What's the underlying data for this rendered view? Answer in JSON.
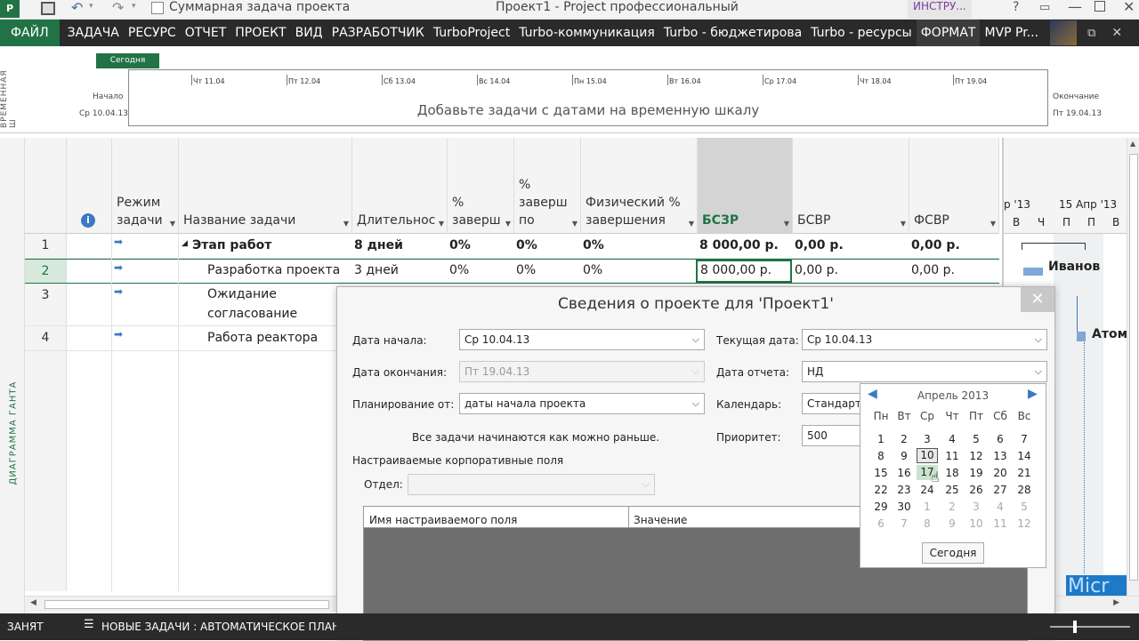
{
  "titlebar": {
    "checkbox_label": "Суммарная задача проекта",
    "window_title": "Проект1 - Project профессиональный",
    "tool_tab": "ИНСТРУ..."
  },
  "ribbon": {
    "tabs": [
      "ФАЙЛ",
      "ЗАДАЧА",
      "РЕСУРС",
      "ОТЧЕТ",
      "ПРОЕКТ",
      "ВИД",
      "РАЗРАБОТЧИК",
      "TurboProject",
      "Turbo-коммуникация",
      "Turbo - бюджетирова",
      "Turbo - ресурсы",
      "ФОРМАТ",
      "MVP Pr..."
    ]
  },
  "timeline": {
    "side_label": "ВРЕМЕННАЯ Ш",
    "today_label": "Сегодня",
    "start_label": "Начало",
    "start_date": "Ср 10.04.13",
    "end_label": "Окончание",
    "end_date": "Пт 19.04.13",
    "placeholder": "Добавьте задачи с датами на временную шкалу",
    "ticks": [
      "Чт 11.04",
      "Пт 12.04",
      "Сб 13.04",
      "Вс 14.04",
      "Пн 15.04",
      "Вт 16.04",
      "Ср 17.04",
      "Чт 18.04",
      "Пт 19.04"
    ]
  },
  "gantt_side_label": "ДИАГРАММА ГАНТА",
  "grid": {
    "headers": {
      "mode": "Режим задачи",
      "name": "Название задачи",
      "duration": "Длительнос",
      "pct": "% заверш",
      "pct_work": "% заверш по",
      "phys": "Физический % завершения",
      "bcws": "БСЗР",
      "bcwp": "БСВР",
      "acwp": "ФСВР"
    },
    "rows": [
      {
        "num": "1",
        "name": "Этап работ",
        "duration": "8 дней",
        "pct": "0%",
        "pct_work": "0%",
        "phys": "0%",
        "bcws": "8 000,00 р.",
        "bcwp": "0,00 р.",
        "acwp": "0,00 р."
      },
      {
        "num": "2",
        "name": "Разработка проекта",
        "duration": "3 дней",
        "pct": "0%",
        "pct_work": "0%",
        "phys": "0%",
        "bcws": "8 000,00 р.",
        "bcwp": "0,00 р.",
        "acwp": "0,00 р."
      },
      {
        "num": "3",
        "name": "Ожидание согласование",
        "name_line1": "Ожидание",
        "name_line2": "согласование"
      },
      {
        "num": "4",
        "name": "Работа реактора"
      }
    ]
  },
  "gantt": {
    "hdr_left": "р '13",
    "hdr_right": "15 Апр '13",
    "days": [
      "В",
      "Ч",
      "П",
      "П",
      "В"
    ],
    "label_ivanov": "Иванов",
    "label_atom": "Атом",
    "label_micro": "Micr"
  },
  "dialog": {
    "title": "Сведения о проекте для 'Проект1'",
    "start_date_label": "Дата начала:",
    "start_date_value": "Ср 10.04.13",
    "end_date_label": "Дата окончания:",
    "end_date_value": "Пт 19.04.13",
    "schedule_from_label": "Планирование от:",
    "schedule_from_value": "даты начала проекта",
    "note": "Все задачи начинаются как можно раньше.",
    "current_date_label": "Текущая дата:",
    "current_date_value": "Ср 10.04.13",
    "status_date_label": "Дата отчета:",
    "status_date_value": "НД",
    "calendar_label": "Календарь:",
    "calendar_value": "Стандартн",
    "priority_label": "Приоритет:",
    "priority_value": "500",
    "custom_fields_label": "Настраиваемые корпоративные поля",
    "department_label": "Отдел:",
    "col_field_name": "Имя настраиваемого поля",
    "col_value": "Значение"
  },
  "calendar": {
    "month": "Апрель 2013",
    "weekdays": [
      "Пн",
      "Вт",
      "Ср",
      "Чт",
      "Пт",
      "Сб",
      "Вс"
    ],
    "weeks": [
      [
        "1",
        "2",
        "3",
        "4",
        "5",
        "6",
        "7"
      ],
      [
        "8",
        "9",
        "10",
        "11",
        "12",
        "13",
        "14"
      ],
      [
        "15",
        "16",
        "17",
        "18",
        "19",
        "20",
        "21"
      ],
      [
        "22",
        "23",
        "24",
        "25",
        "26",
        "27",
        "28"
      ],
      [
        "29",
        "30",
        "1",
        "2",
        "3",
        "4",
        "5"
      ],
      [
        "6",
        "7",
        "8",
        "9",
        "10",
        "11",
        "12"
      ]
    ],
    "today_button": "Сегодня"
  },
  "status": {
    "ready": "ЗАНЯТ",
    "new_tasks": "НОВЫЕ ЗАДАЧИ : АВТОМАТИЧЕСКОЕ ПЛАН"
  },
  "colors": {
    "file_tab": "#217346",
    "ribbon_bg": "#2a2a2a",
    "today_marker": "#217346",
    "gantt_bar": "#7fa8d6"
  }
}
